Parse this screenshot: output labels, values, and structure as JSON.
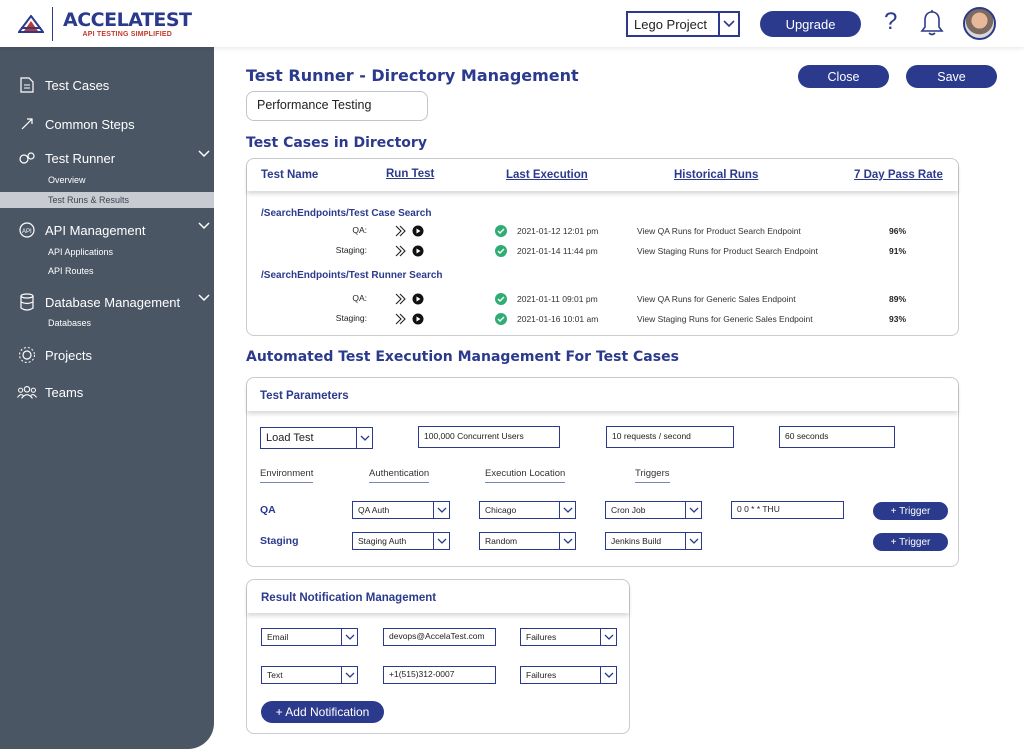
{
  "header": {
    "brand_name": "ACCELATEST",
    "brand_tagline": "API TESTING SIMPLIFIED",
    "project_selected": "Lego Project",
    "upgrade_label": "Upgrade",
    "help_symbol": "?"
  },
  "sidebar": {
    "items": [
      {
        "label": "Test Cases",
        "icon": "document-icon"
      },
      {
        "label": "Common Steps",
        "icon": "steps-icon"
      },
      {
        "label": "Test Runner",
        "icon": "gears-icon"
      },
      {
        "label": "API Management",
        "icon": "api-icon"
      },
      {
        "label": "Database Management",
        "icon": "database-icon"
      },
      {
        "label": "Projects",
        "icon": "projects-icon"
      },
      {
        "label": "Teams",
        "icon": "teams-icon"
      }
    ],
    "test_runner_sub": [
      "Overview",
      "Test Runs & Results"
    ],
    "api_sub": [
      "API Applications",
      "API Routes"
    ],
    "db_sub": [
      "Databases"
    ]
  },
  "page": {
    "title": "Test Runner - Directory Management",
    "close_label": "Close",
    "save_label": "Save",
    "directory_name": "Performance Testing",
    "cases_title": "Test Cases in Directory",
    "automation_title": "Automated Test Execution Management For Test Cases"
  },
  "cases_table": {
    "headers": [
      "Test Name",
      "Run Test",
      "Last Execution",
      "Historical Runs",
      "7 Day Pass Rate"
    ],
    "groups": [
      {
        "path": "/SearchEndpoints/Test Case Search",
        "rows": [
          {
            "env": "QA:",
            "date": "2021-01-12 12:01 pm",
            "history": "View QA Runs for Product Search Endpoint",
            "rate": "96%"
          },
          {
            "env": "Staging:",
            "date": "2021-01-14 11:44 pm",
            "history": "View Staging Runs for Product Search Endpoint",
            "rate": "91%"
          }
        ]
      },
      {
        "path": "/SearchEndpoints/Test Runner Search",
        "rows": [
          {
            "env": "QA:",
            "date": "2021-01-11 09:01 pm",
            "history": "View QA Runs for Generic Sales Endpoint",
            "rate": "89%"
          },
          {
            "env": "Staging:",
            "date": "2021-01-16 10:01 am",
            "history": "View Staging Runs for Generic Sales Endpoint",
            "rate": "93%"
          }
        ]
      }
    ]
  },
  "test_params": {
    "title": "Test Parameters",
    "test_type": "Load Test",
    "users": "100,000 Concurrent Users",
    "rate": "10 requests / second",
    "duration": "60 seconds",
    "tabs": [
      "Environment",
      "Authentication",
      "Execution Location",
      "Triggers"
    ],
    "rows": [
      {
        "env": "QA",
        "auth": "QA Auth",
        "location": "Chicago",
        "trigger": "Cron Job",
        "cron": "0 0 * * THU",
        "button": "+ Trigger"
      },
      {
        "env": "Staging",
        "auth": "Staging Auth",
        "location": "Random",
        "trigger": "Jenkins Build",
        "button": "+ Trigger"
      }
    ]
  },
  "notifications": {
    "title": "Result Notification Management",
    "rows": [
      {
        "channel": "Email",
        "target": "devops@AccelaTest.com",
        "condition": "Failures"
      },
      {
        "channel": "Text",
        "target": "+1(515)312-0007",
        "condition": "Failures"
      }
    ],
    "add_label": "+ Add Notification"
  },
  "colors": {
    "brand": "#2b3a8c",
    "sidebar": "#4b5665",
    "success": "#2eae73"
  }
}
